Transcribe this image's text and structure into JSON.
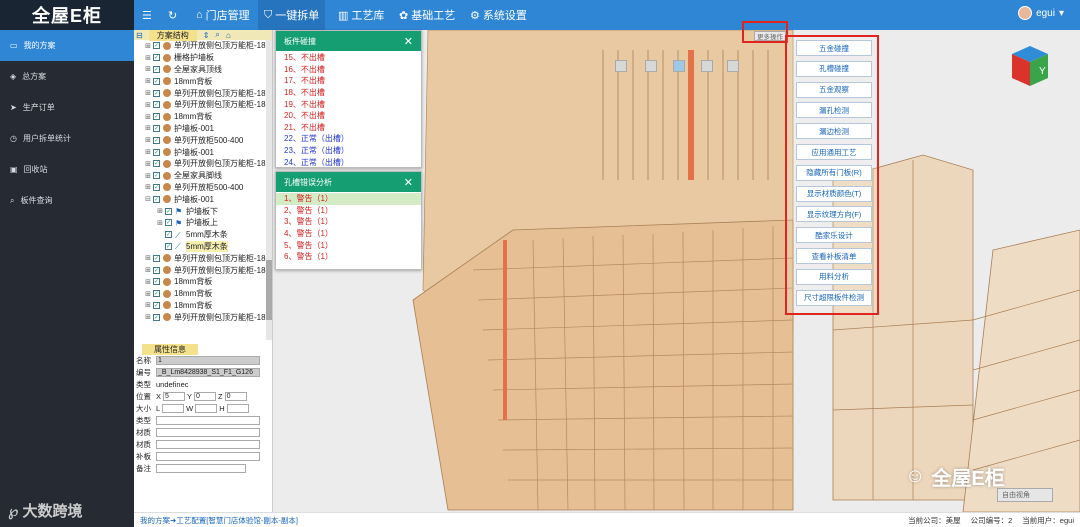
{
  "app": {
    "logo": "全屋E柜"
  },
  "topnav": {
    "menu_icon": "hamburger-icon",
    "refresh_icon": "refresh-icon",
    "items": [
      {
        "label": "门店管理",
        "icon": "home-icon"
      },
      {
        "label": "一键拆单",
        "icon": "shield-icon"
      },
      {
        "label": "工艺库",
        "icon": "bars-icon"
      },
      {
        "label": "基础工艺",
        "icon": "palette-icon"
      },
      {
        "label": "系统设置",
        "icon": "gear-icon"
      }
    ],
    "user": "egui"
  },
  "sidebar": {
    "items": [
      {
        "label": "我的方案",
        "icon": "monitor-icon",
        "active": true
      },
      {
        "label": "总方案",
        "icon": "diamond-icon"
      },
      {
        "label": "生产订单",
        "icon": "send-icon"
      },
      {
        "label": "用户拆单统计",
        "icon": "clock-icon"
      },
      {
        "label": "回收站",
        "icon": "trash-icon"
      },
      {
        "label": "板件查询",
        "icon": "search-icon"
      }
    ],
    "brand": "大数跨境"
  },
  "tree": {
    "title": "方案结构",
    "rows": [
      {
        "label": "单列开放侧包顶万能柜-18",
        "depth": 0,
        "expander": "+",
        "icon": "wood-icon"
      },
      {
        "label": "栅格护墙板",
        "depth": 0,
        "expander": "+",
        "icon": "wood-icon"
      },
      {
        "label": "全屋家具顶线",
        "depth": 0,
        "expander": "+",
        "icon": "wood-icon"
      },
      {
        "label": "18mm背板",
        "depth": 0,
        "expander": "+",
        "icon": "wood-icon"
      },
      {
        "label": "单列开放侧包顶万能柜-18",
        "depth": 0,
        "expander": "+",
        "icon": "wood-icon"
      },
      {
        "label": "单列开放侧包顶万能柜-18",
        "depth": 0,
        "expander": "+",
        "icon": "wood-icon"
      },
      {
        "label": "18mm背板",
        "depth": 0,
        "expander": "+",
        "icon": "wood-icon"
      },
      {
        "label": "护墙板-001",
        "depth": 0,
        "expander": "+",
        "icon": "wood-icon"
      },
      {
        "label": "单列开放柜500-400",
        "depth": 0,
        "expander": "+",
        "icon": "wood-icon"
      },
      {
        "label": "护墙板-001",
        "depth": 0,
        "expander": "+",
        "icon": "wood-icon"
      },
      {
        "label": "单列开放侧包顶万能柜-18",
        "depth": 0,
        "expander": "+",
        "icon": "wood-icon"
      },
      {
        "label": "全屋家具脚线",
        "depth": 0,
        "expander": "+",
        "icon": "wood-icon"
      },
      {
        "label": "单列开放柜500-400",
        "depth": 0,
        "expander": "+",
        "icon": "wood-icon"
      },
      {
        "label": "护墙板-001",
        "depth": 0,
        "expander": "-",
        "icon": "wood-icon"
      },
      {
        "label": "护墙板下",
        "depth": 1,
        "expander": "+",
        "icon": "flag-icon"
      },
      {
        "label": "护墙板上",
        "depth": 1,
        "expander": "+",
        "icon": "flag-icon"
      },
      {
        "label": "5mm厚木条",
        "depth": 1,
        "expander": "",
        "icon": "slash-icon"
      },
      {
        "label": "5mm厚木条",
        "depth": 1,
        "expander": "",
        "icon": "slash-icon",
        "selected": true
      },
      {
        "label": "单列开放侧包顶万能柜-18",
        "depth": 0,
        "expander": "+",
        "icon": "wood-icon"
      },
      {
        "label": "单列开放侧包顶万能柜-18",
        "depth": 0,
        "expander": "+",
        "icon": "wood-icon"
      },
      {
        "label": "18mm背板",
        "depth": 0,
        "expander": "+",
        "icon": "wood-icon"
      },
      {
        "label": "18mm背板",
        "depth": 0,
        "expander": "+",
        "icon": "wood-icon"
      },
      {
        "label": "18mm背板",
        "depth": 0,
        "expander": "+",
        "icon": "wood-icon"
      },
      {
        "label": "单列开放侧包顶万能柜-18",
        "depth": 0,
        "expander": "+",
        "icon": "wood-icon"
      }
    ]
  },
  "props": {
    "title": "属性信息",
    "name_label": "名称",
    "name_value": "1",
    "code_label": "编号",
    "code_value": "_B_Lm8428938_S1_F1_G126",
    "type_label": "类型",
    "type_value": "undefinec",
    "pos_label": "位置",
    "pos_x": "5",
    "pos_y": "0",
    "pos_z": "0",
    "size_label": "大小",
    "rows": [
      "类型",
      "材质",
      "材质",
      "补板",
      "备注"
    ]
  },
  "panel1": {
    "title": "板件碰撞",
    "items": [
      {
        "text": "15、不出槽",
        "kind": "red"
      },
      {
        "text": "16、不出槽",
        "kind": "red"
      },
      {
        "text": "17、不出槽",
        "kind": "red"
      },
      {
        "text": "18、不出槽",
        "kind": "red"
      },
      {
        "text": "19、不出槽",
        "kind": "red"
      },
      {
        "text": "20、不出槽",
        "kind": "red"
      },
      {
        "text": "21、不出槽",
        "kind": "red"
      },
      {
        "text": "22、正常（出槽）",
        "kind": "blue"
      },
      {
        "text": "23、正常（出槽）",
        "kind": "blue"
      },
      {
        "text": "24、正常（出槽）",
        "kind": "blue"
      }
    ]
  },
  "panel2": {
    "title": "孔槽错误分析",
    "items": [
      "1、警告（1）",
      "2、警告（1）",
      "3、警告（1）",
      "4、警告（1）",
      "5、警告（1）",
      "6、警告（1）"
    ]
  },
  "menu": {
    "more_button": "更多操作",
    "items": [
      "五金碰撞",
      "孔槽碰撞",
      "五金观察",
      "漏孔检测",
      "漏边检测",
      "应用通用工艺",
      "隐藏所有门板(R)",
      "显示材质颜色(T)",
      "显示纹理方向(F)",
      "酷家乐设计",
      "查看补板清单",
      "用料分析",
      "尺寸超限板件检测"
    ]
  },
  "cube": {
    "label": "Y"
  },
  "watermark": "全屋E柜",
  "view_select": "自由视角",
  "footer": {
    "crumb": "我的方案➜工艺配置[智慧门店体验馆-副本-副本]",
    "shop": "当前公司：美屋",
    "company_no": "公司编号：2",
    "current_user": "当前用户：egui"
  }
}
